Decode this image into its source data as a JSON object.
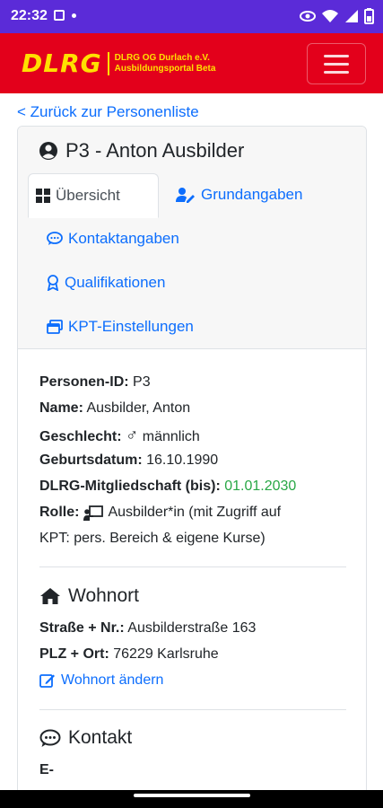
{
  "status_bar": {
    "time": "22:32"
  },
  "navbar": {
    "logo_text": "DLRG",
    "org_line1": "DLRG OG Durlach e.V.",
    "org_line2": "Ausbildungsportal Beta",
    "brand_color": "#e3001b",
    "logo_color": "#ffe000"
  },
  "back_link": "< Zurück zur Personenliste",
  "person": {
    "title": "P3 - Anton Ausbilder"
  },
  "tabs": [
    {
      "label": "Übersicht",
      "icon": "grid-icon",
      "active": true
    },
    {
      "label": "Grundangaben",
      "icon": "user-edit-icon"
    },
    {
      "label": "Kontaktangaben",
      "icon": "chat-icon"
    },
    {
      "label": "Qualifikationen",
      "icon": "award-icon"
    },
    {
      "label": "KPT-Einstellungen",
      "icon": "windows-icon"
    }
  ],
  "overview": {
    "id_label": "Personen-ID:",
    "id_value": "P3",
    "name_label": "Name:",
    "name_value": "Ausbilder, Anton",
    "gender_label": "Geschlecht:",
    "gender_symbol": "♂",
    "gender_value": "männlich",
    "birth_label": "Geburtsdatum:",
    "birth_value": "16.10.1990",
    "membership_label": "DLRG-Mitgliedschaft (bis):",
    "membership_value": "01.01.2030",
    "role_label": "Rolle:",
    "role_value_line1": "Ausbilder*in (mit Zugriff auf",
    "role_value_line2": "KPT: pers. Bereich & eigene Kurse)"
  },
  "wohnort": {
    "title": "Wohnort",
    "street_label": "Straße + Nr.:",
    "street_value": "Ausbilderstraße 163",
    "city_label": "PLZ + Ort:",
    "city_value": "76229 Karlsruhe",
    "edit_link": "Wohnort ändern"
  },
  "kontakt": {
    "title": "Kontakt",
    "email_label_start": "E-"
  }
}
